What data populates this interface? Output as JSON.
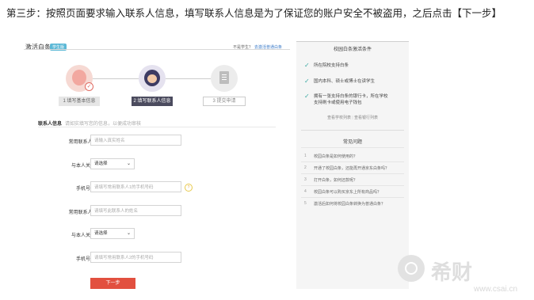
{
  "caption": "第三步：按照页面要求输入联系人信息，填写联系人信息是为了保证您的账户安全不被盗用，之后点击【下一步】",
  "header": {
    "title": "激活白条",
    "tag": "学生版",
    "notice": "不是学生？",
    "notice_link": "去激活普通白条"
  },
  "steps": [
    {
      "label": "1 填写基本信息"
    },
    {
      "label": "2 填写联系人信息"
    },
    {
      "label": "3 提交申请"
    }
  ],
  "section": {
    "title": "联系人信息",
    "hint": "请如实填写您的信息，以便成功审核"
  },
  "form": {
    "contact1_label": "常用联系人1",
    "contact1_placeholder": "请输入真实姓名",
    "relation1_label": "与本人关系",
    "relation1_value": "请选择",
    "phone1_label": "手机号码",
    "phone1_placeholder": "请填写常用联系人1的手机号码",
    "contact2_label": "常用联系人2",
    "contact2_placeholder": "请填写此联系人的姓名",
    "relation2_label": "与本人关系",
    "relation2_value": "请选择",
    "phone2_label": "手机号码",
    "phone2_placeholder": "请填写常用联系人2的手机号码",
    "next_label": "下一步"
  },
  "sidebar": {
    "title": "校园白条激活条件",
    "conditions": [
      "所在院校支持白条",
      "国内本科、硕士或博士在读学生",
      "拥有一张支持白条的银行卡，所在学校支持刷卡或使用电子钱包"
    ],
    "link1": "查看学校列表",
    "link2": "查看银行列表",
    "faq_title": "常见问题",
    "faq": [
      "校园白条是如何使用的？",
      "开通了校园白条，还能再开通京东白条吗？",
      "打开白条，如何还款呢？",
      "校园白条可以购买京东上所有商品吗？",
      "激活后如何将校园白条转换为普通白条？"
    ]
  },
  "watermark": {
    "name": "希财",
    "url": "www.csai.cn"
  }
}
